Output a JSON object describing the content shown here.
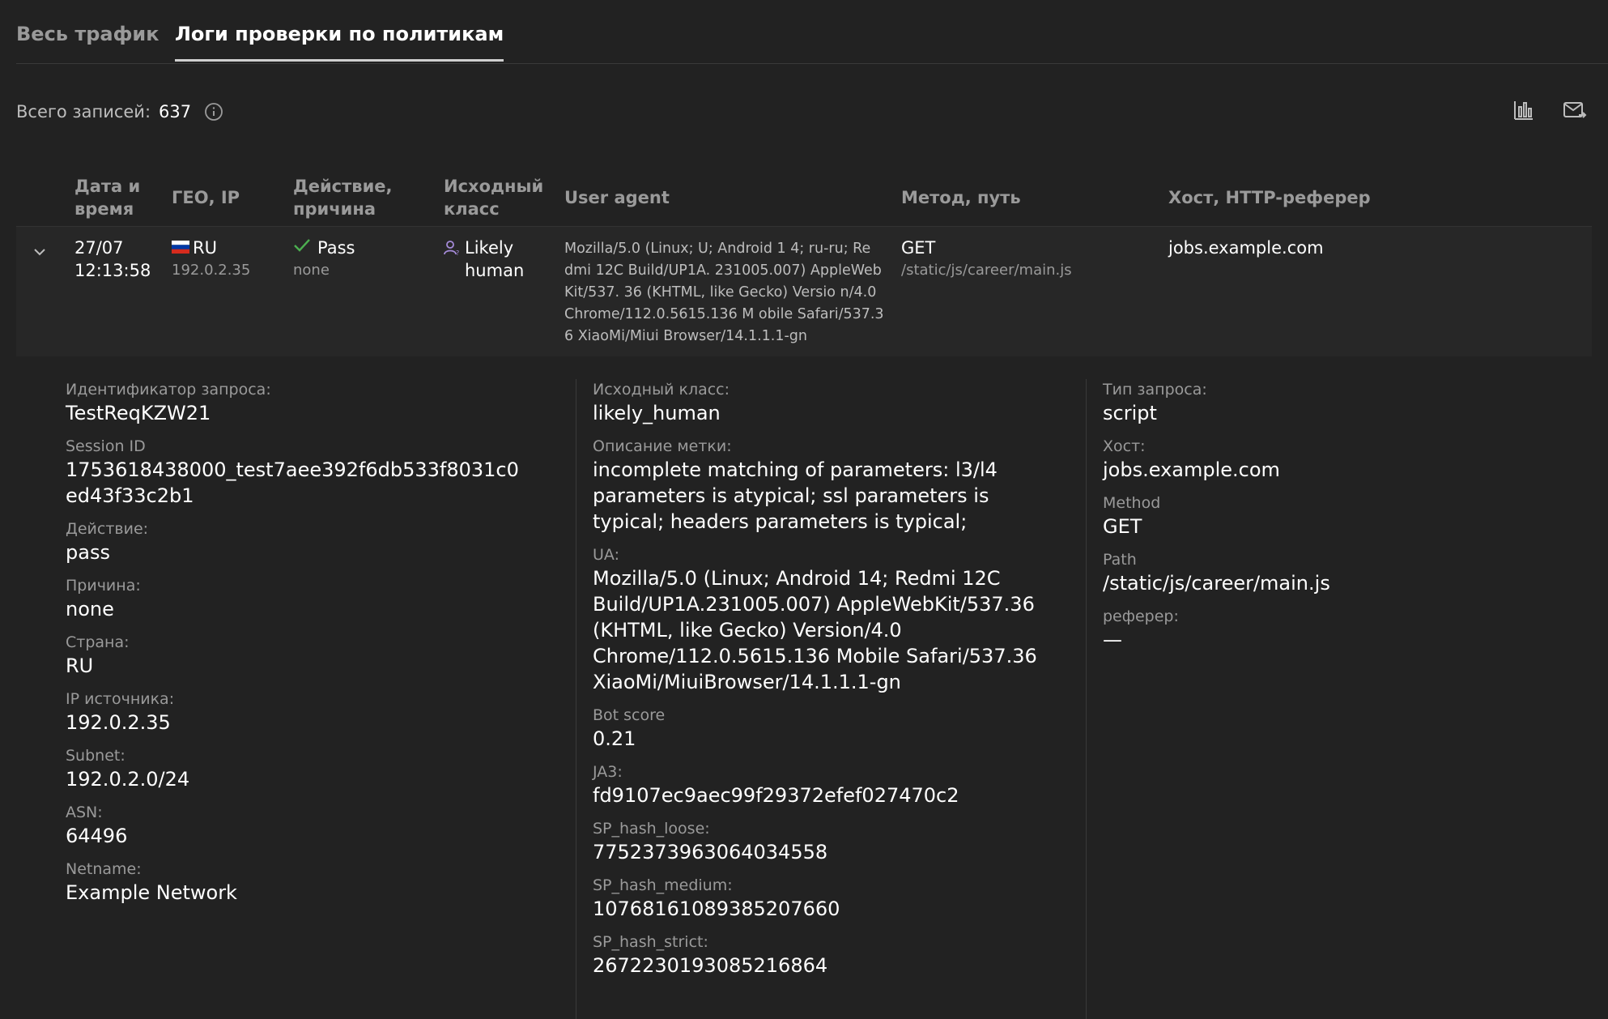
{
  "tabs": [
    {
      "label": "Весь трафик"
    },
    {
      "label": "Логи проверки по политикам"
    }
  ],
  "summary": {
    "label": "Всего записей:",
    "count": "637"
  },
  "icons": {
    "info": "info-icon",
    "chart": "bar-chart-icon",
    "mail": "mail-export-icon",
    "expand": "chevron-down-icon",
    "check": "check-icon",
    "human": "user-icon",
    "flag": "flag-ru-icon"
  },
  "table": {
    "headers": {
      "date": [
        "Дата и",
        "время"
      ],
      "geo": "ГЕО, IP",
      "action": [
        "Действие,",
        "причина"
      ],
      "class": [
        "Исходный",
        "класс"
      ],
      "ua": "User agent",
      "method": "Метод, путь",
      "host": "Хост, HTTP-реферер"
    },
    "row": {
      "date": "27/07",
      "time": "12:13:58",
      "country": "RU",
      "ip": "192.0.2.35",
      "action": "Pass",
      "reason": "none",
      "class_line1": "Likely",
      "class_line2": "human",
      "ua": "Mozilla/5.0 (Linux; U; Android 1 4; ru-ru; Re dmi 12C Build/UP1A. 231005.007) AppleWeb Kit/537. 36 (KHTML, like Gecko) Versio n/4.0 Chrome/112.0.5615.136 M obile Safari/537.3 6 XiaoMi/Miui Browser/14.1.1.1-gn",
      "method": "GET",
      "path": "/static/js/career/main.js",
      "host": "jobs.example.com"
    }
  },
  "details": {
    "col1": [
      {
        "k": "Идентификатор запроса:",
        "v": "TestReqKZW21"
      },
      {
        "k": "Session ID",
        "v": "1753618438000_test7aee392f6db533f8031c0ed43f33c2b1"
      },
      {
        "k": "Действие:",
        "v": "pass"
      },
      {
        "k": "Причина:",
        "v": "none"
      },
      {
        "k": "Страна:",
        "v": "RU"
      },
      {
        "k": "IP источника:",
        "v": "192.0.2.35"
      },
      {
        "k": "Subnet:",
        "v": "192.0.2.0/24"
      },
      {
        "k": "ASN:",
        "v": "64496"
      },
      {
        "k": "Netname:",
        "v": "Example Network"
      }
    ],
    "col2": [
      {
        "k": "Исходный класс:",
        "v": "likely_human"
      },
      {
        "k": "Описание метки:",
        "v": "incomplete matching of parameters: l3/l4 parameters is atypical; ssl parameters is typical; headers parameters is typical;"
      },
      {
        "k": "UA:",
        "v": "Mozilla/5.0 (Linux; Android 14; Redmi 12C Build/UP1A.231005.007) AppleWebKit/537.36 (KHTML, like Gecko) Version/4.0 Chrome/112.0.5615.136 Mobile Safari/537.36 XiaoMi/MiuiBrowser/14.1.1.1-gn"
      },
      {
        "k": "Bot score",
        "v": "0.21"
      },
      {
        "k": "JA3:",
        "v": "fd9107ec9aec99f29372efef027470c2"
      },
      {
        "k": "SP_hash_loose:",
        "v": "7752373963064034558"
      },
      {
        "k": "SP_hash_medium:",
        "v": "10768161089385207660"
      },
      {
        "k": "SP_hash_strict:",
        "v": "2672230193085216864"
      }
    ],
    "col3": [
      {
        "k": "Тип запроса:",
        "v": "script"
      },
      {
        "k": "Хост:",
        "v": "jobs.example.com"
      },
      {
        "k": "Method",
        "v": "GET"
      },
      {
        "k": "Path",
        "v": "/static/js/career/main.js"
      },
      {
        "k": "реферер:",
        "v": "—"
      }
    ]
  },
  "colors": {
    "background": "#222222",
    "row": "#272727",
    "check": "#4caf50",
    "human": "#a58bd9"
  }
}
